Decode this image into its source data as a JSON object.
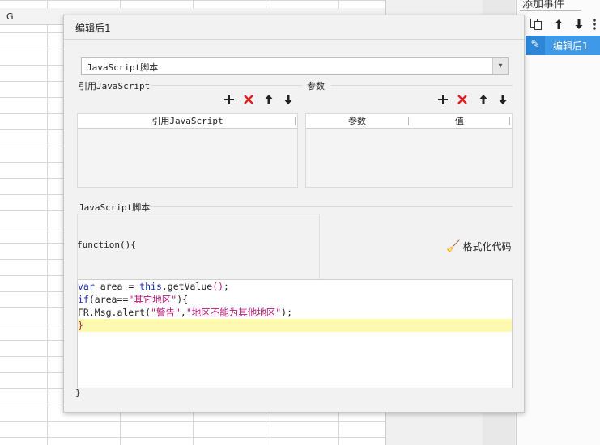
{
  "spreadsheet": {
    "column_label": "G"
  },
  "right_panel": {
    "title": "添加事件",
    "icons": [
      "copy-icon",
      "arrow-up-icon",
      "arrow-down-icon",
      "more-icon"
    ],
    "selected_item": "编辑后1"
  },
  "dialog": {
    "title": "编辑后1",
    "type_select": "JavaScript脚本",
    "ref_section_label": "引用JavaScript",
    "params_section_label": "参数",
    "ref_table_header": "引用JavaScript",
    "params_headers": [
      "参数",
      "值"
    ],
    "toolbar_icons": [
      "add-icon",
      "delete-icon",
      "move-up-icon",
      "move-down-icon"
    ],
    "script_section_label": "JavaScript脚本",
    "function_header": "function(){",
    "format_button": "格式化代码",
    "code_lines": [
      [
        {
          "t": "var",
          "c": "kw"
        },
        {
          "t": " area = ",
          "c": "plain"
        },
        {
          "t": "this",
          "c": "kw"
        },
        {
          "t": ".getValue",
          "c": "plain"
        },
        {
          "t": "()",
          "c": "str"
        },
        {
          "t": ";",
          "c": "plain"
        }
      ],
      [
        {
          "t": "if",
          "c": "kw"
        },
        {
          "t": "(area==",
          "c": "plain"
        },
        {
          "t": "\"其它地区\"",
          "c": "str"
        },
        {
          "t": "){",
          "c": "plain"
        }
      ],
      [
        {
          "t": "FR.Msg.alert(",
          "c": "plain"
        },
        {
          "t": "\"警告\"",
          "c": "str"
        },
        {
          "t": ",",
          "c": "plain"
        },
        {
          "t": "\"地区不能为其他地区\"",
          "c": "str"
        },
        {
          "t": ");",
          "c": "plain"
        }
      ],
      [
        {
          "t": "}",
          "c": "str"
        }
      ]
    ],
    "closing_brace": "}"
  }
}
